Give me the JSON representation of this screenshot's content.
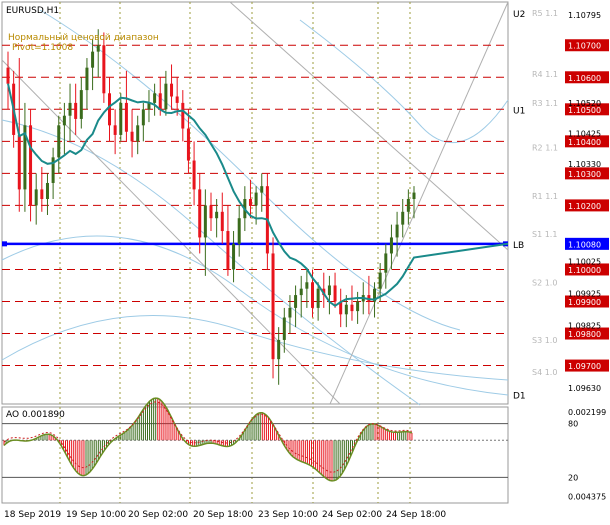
{
  "title": "EURUSD,H1",
  "annotation_line1": "Нормальный ценовой диапазон",
  "annotation_line2": "Pivot=1.1008",
  "colors": {
    "bull": "#3a6b1c",
    "bear": "#e8141d",
    "ma": "#1a8a8a",
    "pivot": "#0000ff",
    "level": "#cc0000",
    "grid": "#9c9c3c"
  },
  "price_levels": [
    {
      "label": "1.10700",
      "value": 1.107,
      "style": "red"
    },
    {
      "label": "1.10600",
      "value": 1.106,
      "style": "red"
    },
    {
      "label": "1.10500",
      "value": 1.105,
      "style": "red"
    },
    {
      "label": "1.10400",
      "value": 1.104,
      "style": "red"
    },
    {
      "label": "1.10300",
      "value": 1.103,
      "style": "red"
    },
    {
      "label": "1.10200",
      "value": 1.102,
      "style": "red"
    },
    {
      "label": "1.10080",
      "value": 1.1008,
      "style": "blue"
    },
    {
      "label": "1.10000",
      "value": 1.1,
      "style": "red"
    },
    {
      "label": "1.09900",
      "value": 1.099,
      "style": "red"
    },
    {
      "label": "1.09800",
      "value": 1.098,
      "style": "red"
    },
    {
      "label": "1.09700",
      "value": 1.097,
      "style": "red"
    }
  ],
  "plain_ticks": [
    {
      "label": "1.10795",
      "value": 1.10795
    },
    {
      "label": "1.10520",
      "value": 1.1052
    },
    {
      "label": "1.10425",
      "value": 1.10425
    },
    {
      "label": "1.10330",
      "value": 1.1033
    },
    {
      "label": "1.10025",
      "value": 1.10025
    },
    {
      "label": "1.09925",
      "value": 1.09925
    },
    {
      "label": "1.09825",
      "value": 1.09825
    },
    {
      "label": "1.09630",
      "value": 1.0963
    }
  ],
  "sr_labels": [
    {
      "label": "R5 1.1",
      "value": 1.108
    },
    {
      "label": "R4 1.1",
      "value": 1.1061
    },
    {
      "label": "R3 1.1",
      "value": 1.1052
    },
    {
      "label": "R2 1.1",
      "value": 1.1038
    },
    {
      "label": "R1 1.1",
      "value": 1.1023
    },
    {
      "label": "S1 1.1",
      "value": 1.1011
    },
    {
      "label": "S2 1.0",
      "value": 1.0996
    },
    {
      "label": "S3 1.0",
      "value": 1.0978
    },
    {
      "label": "S4 1.0",
      "value": 1.0968
    }
  ],
  "band_labels": [
    {
      "label": "U2",
      "value": 1.108
    },
    {
      "label": "U1",
      "value": 1.105
    },
    {
      "label": "LB",
      "value": 1.1008
    },
    {
      "label": "D1",
      "value": 1.0961
    }
  ],
  "ao": {
    "title": "AO 0.001890",
    "ticks": [
      {
        "label": "0.002199",
        "value": 0.002199
      },
      {
        "label": "0.004375",
        "value": -0.004375
      }
    ],
    "levels": [
      {
        "label": "80",
        "value": 0.0013
      },
      {
        "label": "20",
        "value": -0.0029
      }
    ]
  },
  "time_labels": [
    "18 Sep 2019",
    "19 Sep 10:00",
    "20 Sep 02:00",
    "20 Sep 18:00",
    "23 Sep 10:00",
    "24 Sep 02:00",
    "24 Sep 18:00"
  ],
  "chart_data": {
    "type": "candlestick",
    "symbol": "EURUSD",
    "timeframe": "H1",
    "ylim": [
      1.0958,
      1.10835
    ],
    "candles": [
      [
        1.1063,
        1.1068,
        1.105,
        1.1058
      ],
      [
        1.1058,
        1.1062,
        1.1038,
        1.1042
      ],
      [
        1.1042,
        1.1066,
        1.1018,
        1.1025
      ],
      [
        1.1025,
        1.1052,
        1.1018,
        1.1045
      ],
      [
        1.1045,
        1.105,
        1.1015,
        1.102
      ],
      [
        1.102,
        1.103,
        1.1014,
        1.1025
      ],
      [
        1.1025,
        1.1032,
        1.1018,
        1.1022
      ],
      [
        1.1022,
        1.103,
        1.1017,
        1.1027
      ],
      [
        1.1027,
        1.1038,
        1.1022,
        1.1035
      ],
      [
        1.1035,
        1.1048,
        1.103,
        1.1045
      ],
      [
        1.1045,
        1.1052,
        1.1036,
        1.1048
      ],
      [
        1.1048,
        1.1058,
        1.104,
        1.1052
      ],
      [
        1.1052,
        1.1058,
        1.1042,
        1.1047
      ],
      [
        1.1047,
        1.106,
        1.1044,
        1.1056
      ],
      [
        1.1056,
        1.1066,
        1.105,
        1.1063
      ],
      [
        1.1063,
        1.1072,
        1.1056,
        1.1068
      ],
      [
        1.1068,
        1.1075,
        1.106,
        1.107
      ],
      [
        1.107,
        1.1074,
        1.1052,
        1.1055
      ],
      [
        1.1055,
        1.106,
        1.104,
        1.1045
      ],
      [
        1.1045,
        1.105,
        1.1036,
        1.1042
      ],
      [
        1.1042,
        1.1055,
        1.104,
        1.1052
      ],
      [
        1.1052,
        1.1062,
        1.104,
        1.1043
      ],
      [
        1.1043,
        1.105,
        1.1035,
        1.104
      ],
      [
        1.104,
        1.1048,
        1.1036,
        1.1045
      ],
      [
        1.1045,
        1.1052,
        1.104,
        1.105
      ],
      [
        1.105,
        1.1056,
        1.1046,
        1.1052
      ],
      [
        1.1052,
        1.1058,
        1.1048,
        1.1055
      ],
      [
        1.1055,
        1.106,
        1.1048,
        1.105
      ],
      [
        1.105,
        1.1062,
        1.1048,
        1.1058
      ],
      [
        1.1058,
        1.1064,
        1.105,
        1.1054
      ],
      [
        1.1054,
        1.106,
        1.1048,
        1.1052
      ],
      [
        1.1052,
        1.1056,
        1.104,
        1.1044
      ],
      [
        1.1044,
        1.105,
        1.103,
        1.1034
      ],
      [
        1.1034,
        1.104,
        1.102,
        1.1025
      ],
      [
        1.1025,
        1.103,
        1.1005,
        1.101
      ],
      [
        1.101,
        1.1025,
        1.0998,
        1.102
      ],
      [
        1.102,
        1.1024,
        1.1012,
        1.1016
      ],
      [
        1.1016,
        1.1022,
        1.101,
        1.1018
      ],
      [
        1.1018,
        1.1024,
        1.1008,
        1.1012
      ],
      [
        1.1012,
        1.102,
        1.0998,
        1.1
      ],
      [
        1.1,
        1.1012,
        1.0996,
        1.1008
      ],
      [
        1.1008,
        1.102,
        1.1004,
        1.1016
      ],
      [
        1.1016,
        1.1026,
        1.1012,
        1.1022
      ],
      [
        1.1022,
        1.1028,
        1.1016,
        1.102
      ],
      [
        1.102,
        1.1026,
        1.1014,
        1.1024
      ],
      [
        1.1024,
        1.103,
        1.1018,
        1.1026
      ],
      [
        1.1026,
        1.103,
        1.1,
        1.1005
      ],
      [
        1.1005,
        1.101,
        1.0966,
        1.0972
      ],
      [
        1.0972,
        1.0982,
        1.0964,
        1.0978
      ],
      [
        1.0978,
        1.0988,
        1.0974,
        1.0985
      ],
      [
        1.0985,
        1.0992,
        1.098,
        1.0988
      ],
      [
        1.0988,
        1.0995,
        1.0982,
        1.0992
      ],
      [
        1.0992,
        1.0998,
        1.0985,
        1.0994
      ],
      [
        1.0994,
        1.1,
        1.0988,
        1.0996
      ],
      [
        1.0996,
        1.1,
        1.0985,
        1.0988
      ],
      [
        1.0988,
        1.0996,
        1.0984,
        1.0994
      ],
      [
        1.0994,
        1.0999,
        1.0988,
        1.0992
      ],
      [
        1.0992,
        1.0998,
        1.0986,
        1.0995
      ],
      [
        1.0995,
        1.0999,
        1.0988,
        1.099
      ],
      [
        1.099,
        1.0994,
        1.0982,
        1.0986
      ],
      [
        1.0986,
        1.0992,
        1.0982,
        1.0989
      ],
      [
        1.0989,
        1.0995,
        1.0984,
        1.0987
      ],
      [
        1.0987,
        1.0993,
        1.0983,
        1.099
      ],
      [
        1.099,
        1.0996,
        1.0986,
        1.0992
      ],
      [
        1.0992,
        1.0998,
        1.0986,
        1.099
      ],
      [
        1.099,
        1.0996,
        1.0985,
        1.0994
      ],
      [
        1.0994,
        1.1002,
        1.099,
        1.0999
      ],
      [
        1.0999,
        1.1008,
        1.0994,
        1.1005
      ],
      [
        1.1005,
        1.1014,
        1.1,
        1.101
      ],
      [
        1.101,
        1.1018,
        1.1004,
        1.1014
      ],
      [
        1.1014,
        1.1022,
        1.101,
        1.1018
      ],
      [
        1.1018,
        1.1025,
        1.1014,
        1.1022
      ],
      [
        1.1022,
        1.1026,
        1.1016,
        1.1024
      ]
    ]
  }
}
